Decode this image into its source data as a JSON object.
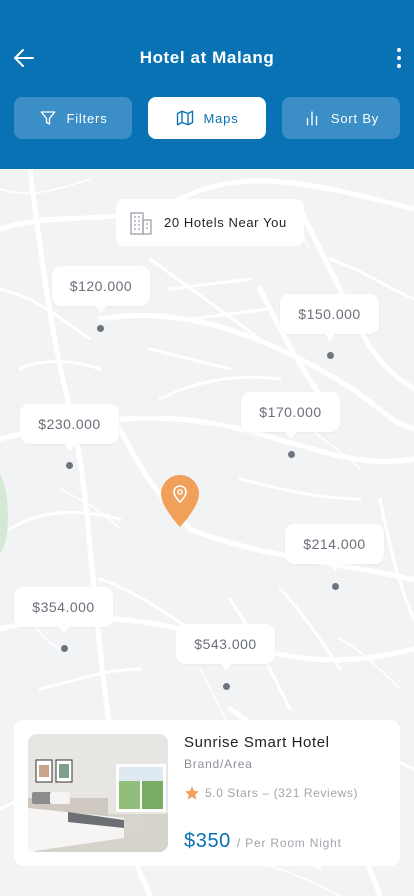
{
  "header": {
    "title": "Hotel at Malang",
    "back_icon": "arrow-left-icon",
    "more_icon": "more-vertical-icon"
  },
  "tabs": [
    {
      "label": "Filters",
      "icon": "filter-icon",
      "active": false
    },
    {
      "label": "Maps",
      "icon": "map-icon",
      "active": true
    },
    {
      "label": "Sort By",
      "icon": "bar-chart-icon",
      "active": false
    }
  ],
  "map": {
    "hotels_near_label": "20 Hotels Near You",
    "hotels_near_icon": "building-icon",
    "location_pin_icon": "location-pin-icon",
    "price_markers": [
      {
        "price": "$120.000"
      },
      {
        "price": "$150.000"
      },
      {
        "price": "$230.000"
      },
      {
        "price": "$170.000"
      },
      {
        "price": "$214.000"
      },
      {
        "price": "$354.000"
      },
      {
        "price": "$543.000"
      }
    ]
  },
  "hotel_card": {
    "name": "Sunrise Smart Hotel",
    "brand": "Brand/Area",
    "rating_text": "5.0 Stars – (321 Reviews)",
    "price": "$350",
    "price_unit": "/ Per Room Night",
    "star_icon": "star-icon",
    "image": "hotel-room-photo"
  },
  "colors": {
    "primary": "#0872b4",
    "tab_inactive": "#3b8fc6",
    "accent_pin": "#f1a05a",
    "map_background": "#f2f3f5"
  }
}
